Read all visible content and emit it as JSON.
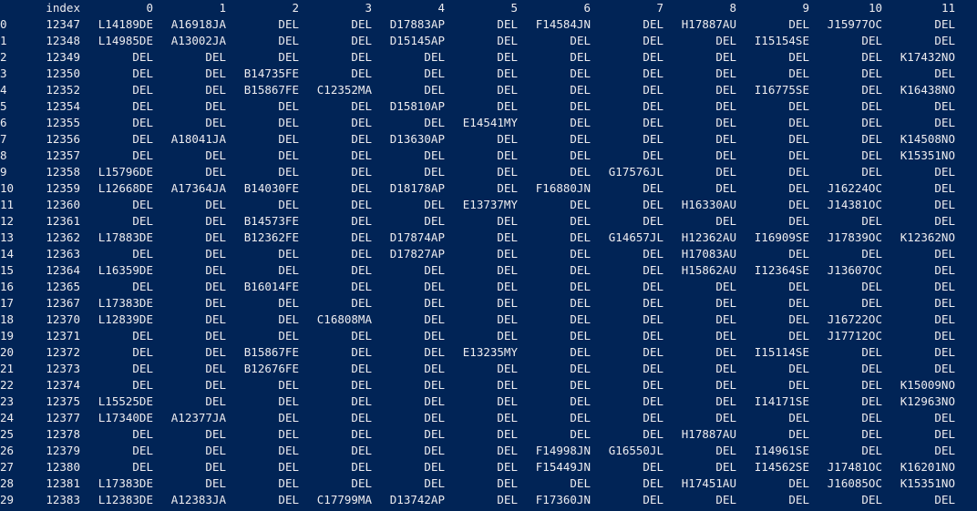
{
  "console": {
    "background": "#012456",
    "foreground": "#eeedf0"
  },
  "table": {
    "columns": [
      "index",
      "0",
      "1",
      "2",
      "3",
      "4",
      "5",
      "6",
      "7",
      "8",
      "9",
      "10",
      "11"
    ],
    "rows": [
      {
        "label": "0",
        "cells": [
          "12347",
          "L14189DE",
          "A16918JA",
          "DEL",
          "DEL",
          "D17883AP",
          "DEL",
          "F14584JN",
          "DEL",
          "H17887AU",
          "DEL",
          "J15977OC",
          "DEL"
        ]
      },
      {
        "label": "1",
        "cells": [
          "12348",
          "L14985DE",
          "A13002JA",
          "DEL",
          "DEL",
          "D15145AP",
          "DEL",
          "DEL",
          "DEL",
          "DEL",
          "I15154SE",
          "DEL",
          "DEL"
        ]
      },
      {
        "label": "2",
        "cells": [
          "12349",
          "DEL",
          "DEL",
          "DEL",
          "DEL",
          "DEL",
          "DEL",
          "DEL",
          "DEL",
          "DEL",
          "DEL",
          "DEL",
          "K17432NO"
        ]
      },
      {
        "label": "3",
        "cells": [
          "12350",
          "DEL",
          "DEL",
          "B14735FE",
          "DEL",
          "DEL",
          "DEL",
          "DEL",
          "DEL",
          "DEL",
          "DEL",
          "DEL",
          "DEL"
        ]
      },
      {
        "label": "4",
        "cells": [
          "12352",
          "DEL",
          "DEL",
          "B15867FE",
          "C12352MA",
          "DEL",
          "DEL",
          "DEL",
          "DEL",
          "DEL",
          "I16775SE",
          "DEL",
          "K16438NO"
        ]
      },
      {
        "label": "5",
        "cells": [
          "12354",
          "DEL",
          "DEL",
          "DEL",
          "DEL",
          "D15810AP",
          "DEL",
          "DEL",
          "DEL",
          "DEL",
          "DEL",
          "DEL",
          "DEL"
        ]
      },
      {
        "label": "6",
        "cells": [
          "12355",
          "DEL",
          "DEL",
          "DEL",
          "DEL",
          "DEL",
          "E14541MY",
          "DEL",
          "DEL",
          "DEL",
          "DEL",
          "DEL",
          "DEL"
        ]
      },
      {
        "label": "7",
        "cells": [
          "12356",
          "DEL",
          "A18041JA",
          "DEL",
          "DEL",
          "D13630AP",
          "DEL",
          "DEL",
          "DEL",
          "DEL",
          "DEL",
          "DEL",
          "K14508NO"
        ]
      },
      {
        "label": "8",
        "cells": [
          "12357",
          "DEL",
          "DEL",
          "DEL",
          "DEL",
          "DEL",
          "DEL",
          "DEL",
          "DEL",
          "DEL",
          "DEL",
          "DEL",
          "K15351NO"
        ]
      },
      {
        "label": "9",
        "cells": [
          "12358",
          "L15796DE",
          "DEL",
          "DEL",
          "DEL",
          "DEL",
          "DEL",
          "DEL",
          "G17576JL",
          "DEL",
          "DEL",
          "DEL",
          "DEL"
        ]
      },
      {
        "label": "10",
        "cells": [
          "12359",
          "L12668DE",
          "A17364JA",
          "B14030FE",
          "DEL",
          "D18178AP",
          "DEL",
          "F16880JN",
          "DEL",
          "DEL",
          "DEL",
          "J16224OC",
          "DEL"
        ]
      },
      {
        "label": "11",
        "cells": [
          "12360",
          "DEL",
          "DEL",
          "DEL",
          "DEL",
          "DEL",
          "E13737MY",
          "DEL",
          "DEL",
          "H16330AU",
          "DEL",
          "J14381OC",
          "DEL"
        ]
      },
      {
        "label": "12",
        "cells": [
          "12361",
          "DEL",
          "DEL",
          "B14573FE",
          "DEL",
          "DEL",
          "DEL",
          "DEL",
          "DEL",
          "DEL",
          "DEL",
          "DEL",
          "DEL"
        ]
      },
      {
        "label": "13",
        "cells": [
          "12362",
          "L17883DE",
          "DEL",
          "B12362FE",
          "DEL",
          "D17874AP",
          "DEL",
          "DEL",
          "G14657JL",
          "H12362AU",
          "I16909SE",
          "J17839OC",
          "K12362NO"
        ]
      },
      {
        "label": "14",
        "cells": [
          "12363",
          "DEL",
          "DEL",
          "DEL",
          "DEL",
          "D17827AP",
          "DEL",
          "DEL",
          "DEL",
          "H17083AU",
          "DEL",
          "DEL",
          "DEL"
        ]
      },
      {
        "label": "15",
        "cells": [
          "12364",
          "L16359DE",
          "DEL",
          "DEL",
          "DEL",
          "DEL",
          "DEL",
          "DEL",
          "DEL",
          "H15862AU",
          "I12364SE",
          "J13607OC",
          "DEL"
        ]
      },
      {
        "label": "16",
        "cells": [
          "12365",
          "DEL",
          "DEL",
          "B16014FE",
          "DEL",
          "DEL",
          "DEL",
          "DEL",
          "DEL",
          "DEL",
          "DEL",
          "DEL",
          "DEL"
        ]
      },
      {
        "label": "17",
        "cells": [
          "12367",
          "L17383DE",
          "DEL",
          "DEL",
          "DEL",
          "DEL",
          "DEL",
          "DEL",
          "DEL",
          "DEL",
          "DEL",
          "DEL",
          "DEL"
        ]
      },
      {
        "label": "18",
        "cells": [
          "12370",
          "L12839DE",
          "DEL",
          "DEL",
          "C16808MA",
          "DEL",
          "DEL",
          "DEL",
          "DEL",
          "DEL",
          "DEL",
          "J16722OC",
          "DEL"
        ]
      },
      {
        "label": "19",
        "cells": [
          "12371",
          "DEL",
          "DEL",
          "DEL",
          "DEL",
          "DEL",
          "DEL",
          "DEL",
          "DEL",
          "DEL",
          "DEL",
          "J17712OC",
          "DEL"
        ]
      },
      {
        "label": "20",
        "cells": [
          "12372",
          "DEL",
          "DEL",
          "B15867FE",
          "DEL",
          "DEL",
          "E13235MY",
          "DEL",
          "DEL",
          "DEL",
          "I15114SE",
          "DEL",
          "DEL"
        ]
      },
      {
        "label": "21",
        "cells": [
          "12373",
          "DEL",
          "DEL",
          "B12676FE",
          "DEL",
          "DEL",
          "DEL",
          "DEL",
          "DEL",
          "DEL",
          "DEL",
          "DEL",
          "DEL"
        ]
      },
      {
        "label": "22",
        "cells": [
          "12374",
          "DEL",
          "DEL",
          "DEL",
          "DEL",
          "DEL",
          "DEL",
          "DEL",
          "DEL",
          "DEL",
          "DEL",
          "DEL",
          "K15009NO"
        ]
      },
      {
        "label": "23",
        "cells": [
          "12375",
          "L15525DE",
          "DEL",
          "DEL",
          "DEL",
          "DEL",
          "DEL",
          "DEL",
          "DEL",
          "DEL",
          "I14171SE",
          "DEL",
          "K12963NO"
        ]
      },
      {
        "label": "24",
        "cells": [
          "12377",
          "L17340DE",
          "A12377JA",
          "DEL",
          "DEL",
          "DEL",
          "DEL",
          "DEL",
          "DEL",
          "DEL",
          "DEL",
          "DEL",
          "DEL"
        ]
      },
      {
        "label": "25",
        "cells": [
          "12378",
          "DEL",
          "DEL",
          "DEL",
          "DEL",
          "DEL",
          "DEL",
          "DEL",
          "DEL",
          "H17887AU",
          "DEL",
          "DEL",
          "DEL"
        ]
      },
      {
        "label": "26",
        "cells": [
          "12379",
          "DEL",
          "DEL",
          "DEL",
          "DEL",
          "DEL",
          "DEL",
          "F14998JN",
          "G16550JL",
          "DEL",
          "I14961SE",
          "DEL",
          "DEL"
        ]
      },
      {
        "label": "27",
        "cells": [
          "12380",
          "DEL",
          "DEL",
          "DEL",
          "DEL",
          "DEL",
          "DEL",
          "F15449JN",
          "DEL",
          "DEL",
          "I14562SE",
          "J17481OC",
          "K16201NO"
        ]
      },
      {
        "label": "28",
        "cells": [
          "12381",
          "L17383DE",
          "DEL",
          "DEL",
          "DEL",
          "DEL",
          "DEL",
          "DEL",
          "DEL",
          "H17451AU",
          "DEL",
          "J16085OC",
          "K15351NO"
        ]
      },
      {
        "label": "29",
        "cells": [
          "12383",
          "L12383DE",
          "A12383JA",
          "DEL",
          "C17799MA",
          "D13742AP",
          "DEL",
          "F17360JN",
          "DEL",
          "DEL",
          "DEL",
          "DEL",
          "DEL"
        ]
      }
    ]
  }
}
